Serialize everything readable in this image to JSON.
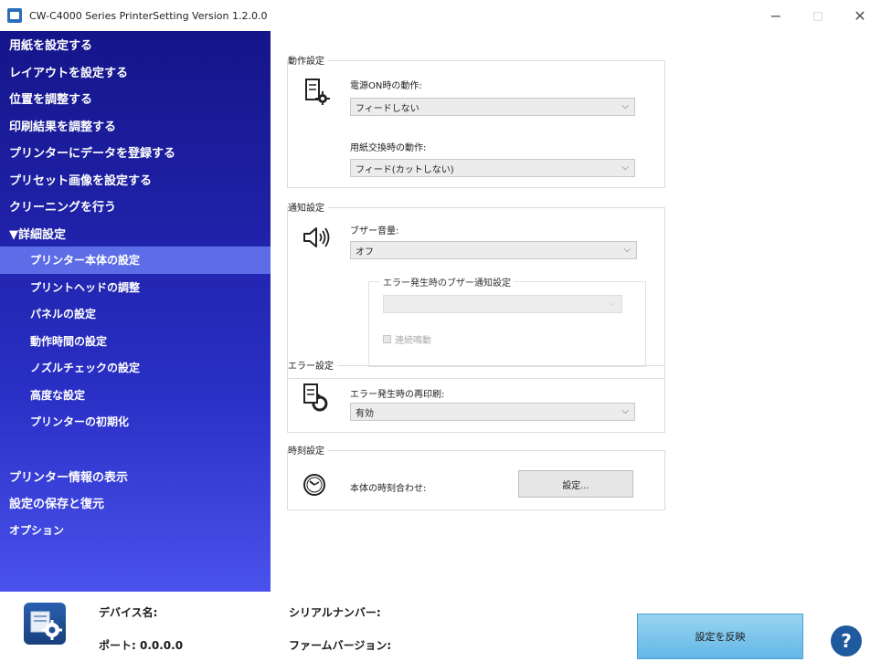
{
  "window": {
    "title": "CW-C4000 Series PrinterSetting Version 1.2.0.0",
    "minimize": "−",
    "maximize": "□",
    "close": "✕"
  },
  "sidebar": {
    "items": [
      {
        "label": "用紙を設定する"
      },
      {
        "label": "レイアウトを設定する"
      },
      {
        "label": "位置を調整する"
      },
      {
        "label": "印刷結果を調整する"
      },
      {
        "label": "プリンターにデータを登録する"
      },
      {
        "label": "プリセット画像を設定する"
      },
      {
        "label": "クリーニングを行う"
      },
      {
        "label": "▼詳細設定"
      }
    ],
    "subitems": [
      {
        "label": "プリンター本体の設定"
      },
      {
        "label": "プリントヘッドの調整"
      },
      {
        "label": "パネルの設定"
      },
      {
        "label": "動作時間の設定"
      },
      {
        "label": "ノズルチェックの設定"
      },
      {
        "label": "高度な設定"
      },
      {
        "label": "プリンターの初期化"
      }
    ],
    "bottom_items": [
      {
        "label": "プリンター情報の表示"
      },
      {
        "label": "設定の保存と復元"
      },
      {
        "label": "オプション"
      }
    ],
    "active": "プリンター本体の設定"
  },
  "operation": {
    "group_title": "動作設定",
    "power_on_label": "電源ON時の動作:",
    "power_on_value": "フィードしない",
    "paper_change_label": "用紙交換時の動作:",
    "paper_change_value": "フィード(カットしない)"
  },
  "notification": {
    "group_title": "通知設定",
    "buzzer_label": "ブザー音量:",
    "buzzer_value": "オフ",
    "error_buzzer_title": "エラー発生時のブザー通知設定",
    "error_buzzer_value": "",
    "continuous_label": "連続鳴動"
  },
  "error": {
    "group_title": "エラー設定",
    "reprint_label": "エラー発生時の再印刷:",
    "reprint_value": "有効"
  },
  "clock": {
    "group_title": "時刻設定",
    "sync_label": "本体の時刻合わせ:",
    "set_button": "設定..."
  },
  "footer": {
    "device_name_label": "デバイス名:",
    "port_label": "ポート: 0.0.0.0",
    "serial_label": "シリアルナンバー:",
    "firmware_label": "ファームバージョン:",
    "apply_button": "設定を反映",
    "help_button": "?"
  },
  "colors": {
    "sidebar_top": "#15158a",
    "sidebar_bottom": "#4a52ec",
    "active_item": "#5d6de8",
    "apply_button": "#62b7e6",
    "help_button": "#1f5a9e"
  }
}
